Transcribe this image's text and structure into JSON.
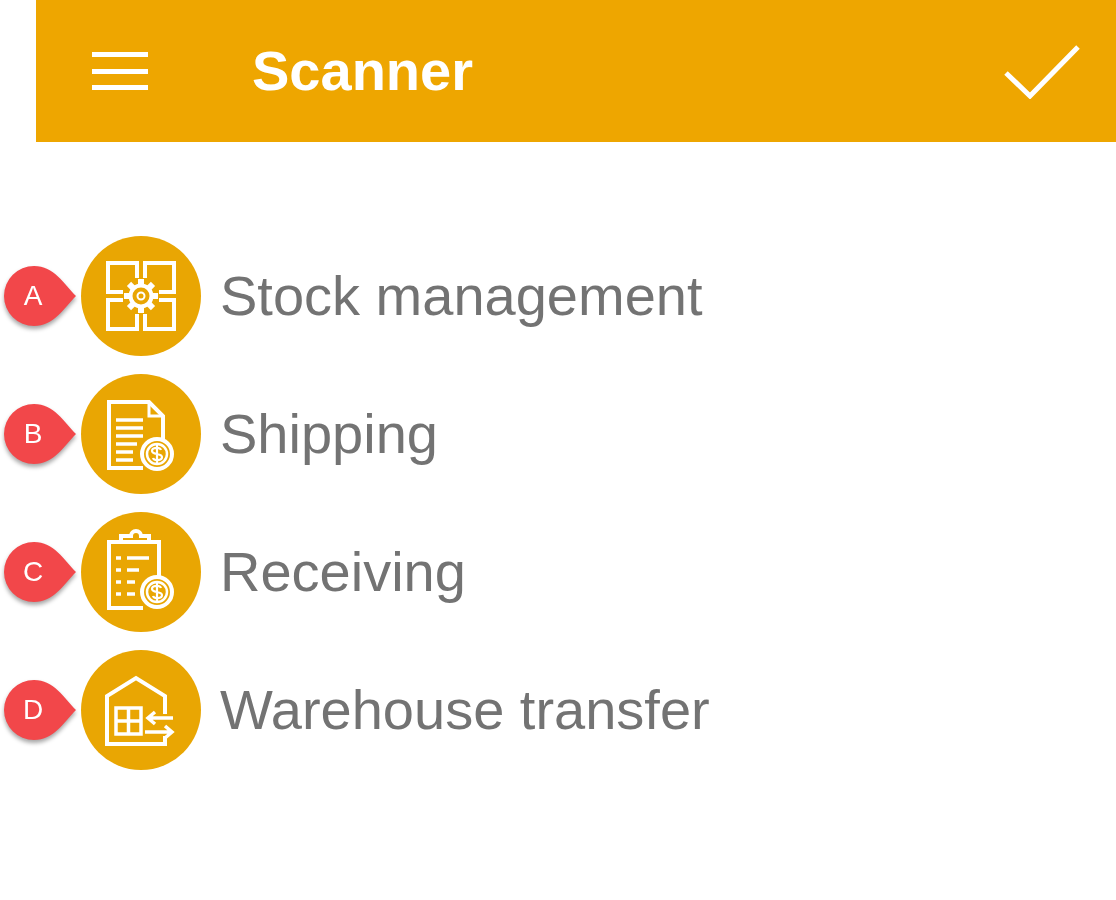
{
  "app_bar": {
    "title": "Scanner"
  },
  "menu_items": [
    {
      "callout": "A",
      "label": "Stock management"
    },
    {
      "callout": "B",
      "label": "Shipping"
    },
    {
      "callout": "C",
      "label": "Receiving"
    },
    {
      "callout": "D",
      "label": "Warehouse transfer"
    }
  ]
}
